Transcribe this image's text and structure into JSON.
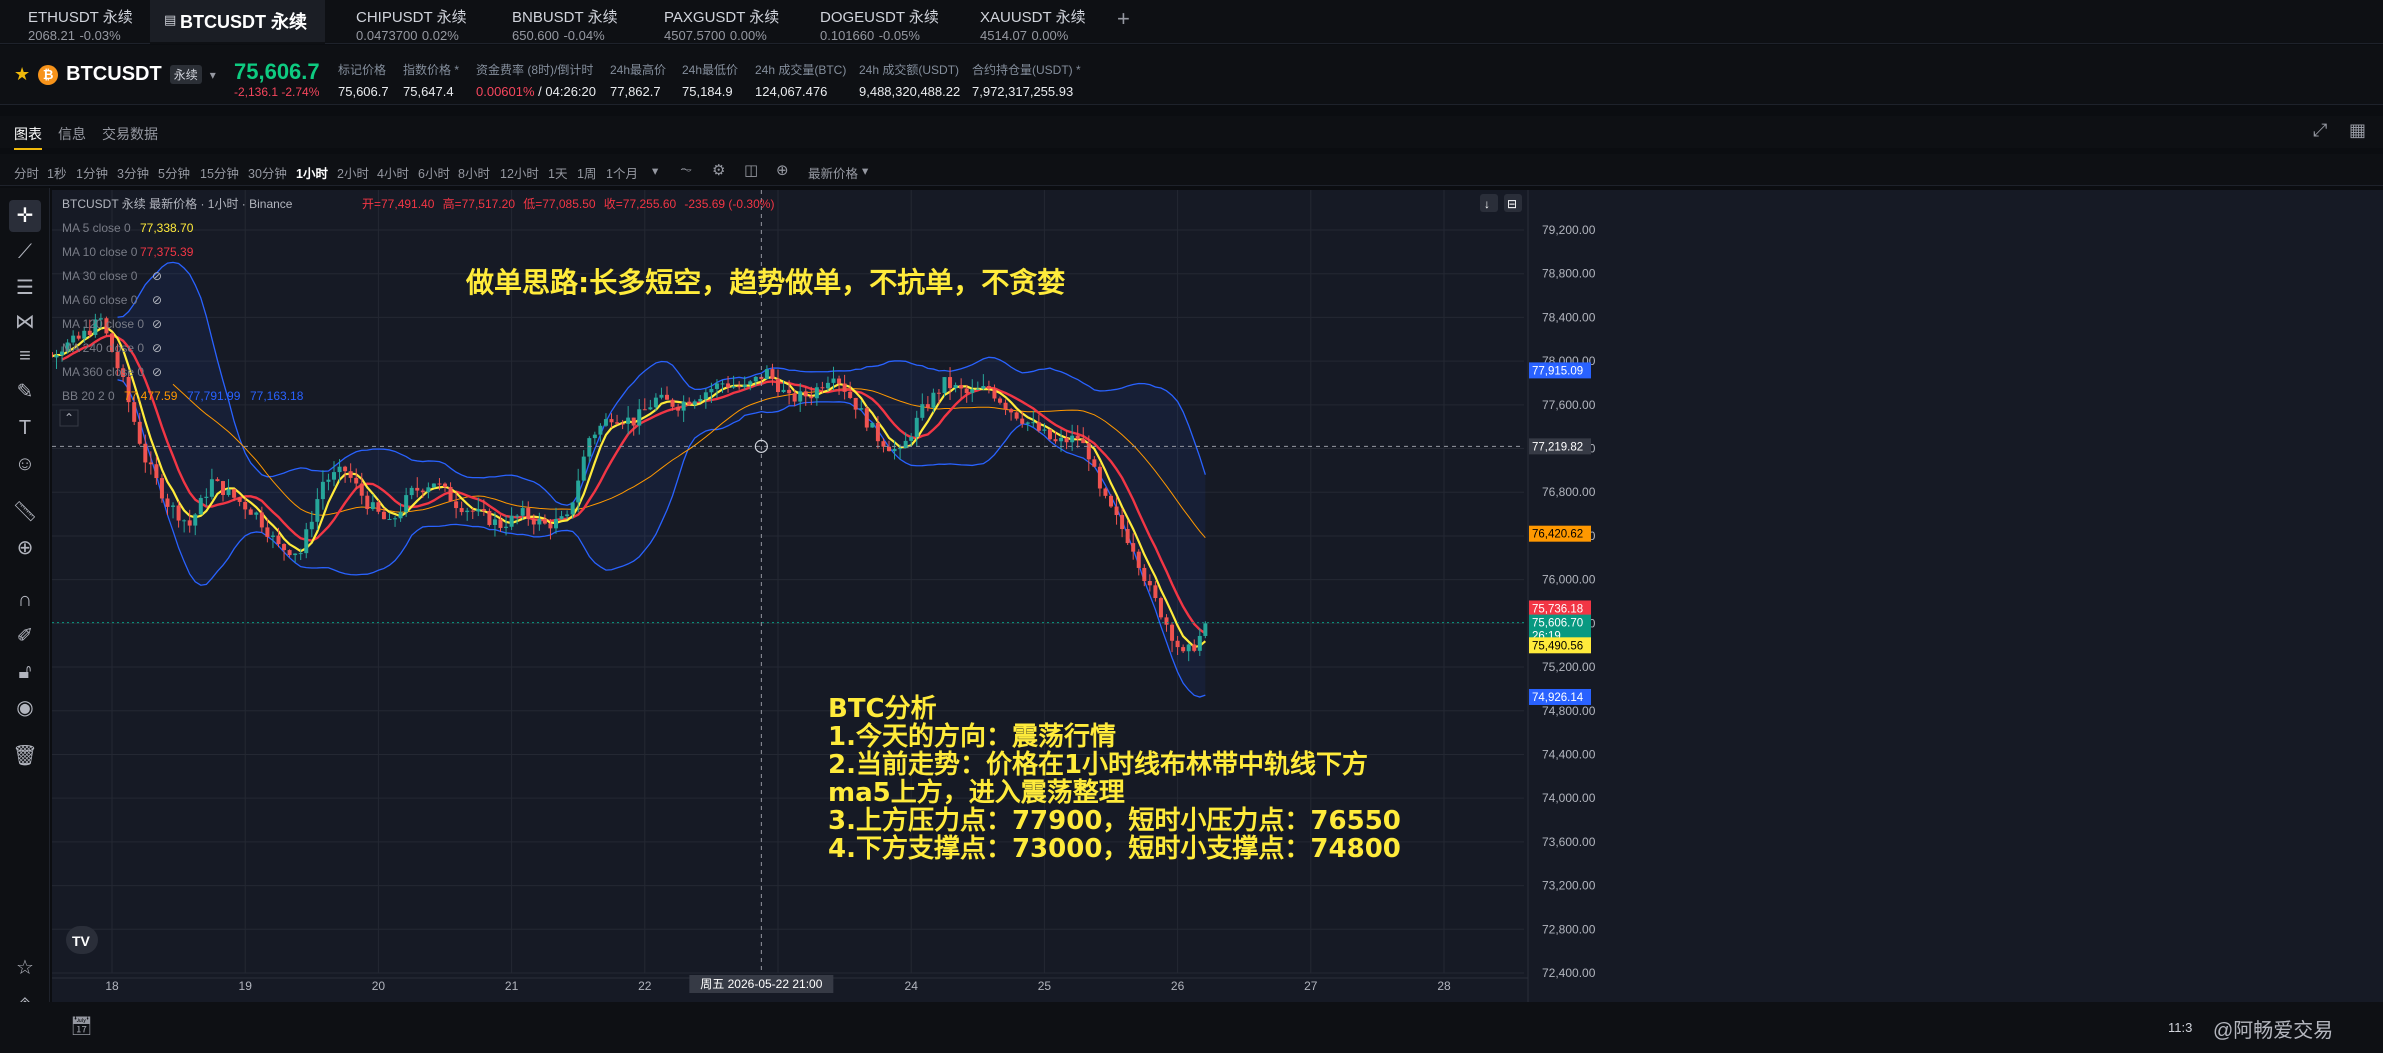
{
  "tabs": [
    {
      "name": "ETHUSDT 永续",
      "price": "2068.21",
      "change": "-0.03%",
      "dir": "neg"
    },
    {
      "name": "BTCUSDT 永续",
      "price": "",
      "change": "",
      "dir": "",
      "active": true
    },
    {
      "name": "CHIPUSDT 永续",
      "price": "0.0473700",
      "change": "0.02%",
      "dir": "pos"
    },
    {
      "name": "BNBUSDT 永续",
      "price": "650.600",
      "change": "-0.04%",
      "dir": "neg"
    },
    {
      "name": "PAXGUSDT 永续",
      "price": "4507.5700",
      "change": "0.00%",
      "dir": "pos"
    },
    {
      "name": "DOGEUSDT 永续",
      "price": "0.101660",
      "change": "-0.05%",
      "dir": "neg"
    },
    {
      "name": "XAUUSDT 永续",
      "price": "4514.07",
      "change": "0.00%",
      "dir": "pos"
    }
  ],
  "add_tab": "+",
  "header": {
    "symbol": "BTCUSDT",
    "badge": "永续",
    "last_price": "75,606.7",
    "change": "-2,136.1 -2.74%",
    "stats": [
      {
        "label": "标记价格",
        "value": "75,606.7",
        "cls": ""
      },
      {
        "label": "指数价格 *",
        "value": "75,647.4",
        "cls": ""
      },
      {
        "label": "资金费率 (8时)/倒计时",
        "value": "0.00601%",
        "value2": " / 04:26:20",
        "cls": "neg"
      },
      {
        "label": "24h最高价",
        "value": "77,862.7",
        "cls": ""
      },
      {
        "label": "24h最低价",
        "value": "75,184.9",
        "cls": ""
      },
      {
        "label": "24h 成交量(BTC)",
        "value": "124,067.476",
        "cls": ""
      },
      {
        "label": "24h 成交额(USDT)",
        "value": "9,488,320,488.22",
        "cls": ""
      },
      {
        "label": "合约持仓量(USDT) *",
        "value": "7,972,317,255.93",
        "cls": ""
      }
    ]
  },
  "subtabs": [
    "图表",
    "信息",
    "交易数据"
  ],
  "timeframes": [
    "分时",
    "1秒",
    "1分钟",
    "3分钟",
    "5分钟",
    "15分钟",
    "30分钟",
    "1小时",
    "2小时",
    "4小时",
    "6小时",
    "8小时",
    "12小时",
    "1天",
    "1周",
    "1个月"
  ],
  "active_timeframe": "1小时",
  "price_type": "最新价格",
  "chart_data": {
    "type": "candlestick",
    "title": "BTCUSDT 永续 最新价格 · 1小时 · Binance",
    "ohlc": {
      "open": "开=77,491.40",
      "high": "高=77,517.20",
      "low": "低=77,085.50",
      "close": "收=77,255.60",
      "change": "-235.69 (-0.30%)"
    },
    "indicators": [
      {
        "label": "MA 5 close 0",
        "value": "77,338.70",
        "color": "#ffeb3b"
      },
      {
        "label": "MA 10 close 0",
        "value": "77,375.39",
        "color": "#f23645"
      },
      {
        "label": "MA 30 close 0",
        "value": "",
        "color": "#787b86"
      },
      {
        "label": "MA 60 close 0",
        "value": "",
        "color": "#787b86"
      },
      {
        "label": "MA 120 close 0",
        "value": "",
        "color": "#787b86"
      },
      {
        "label": "MA 240 close 0",
        "value": "",
        "color": "#787b86"
      },
      {
        "label": "MA 360 close 0",
        "value": "",
        "color": "#787b86"
      }
    ],
    "bb": {
      "label": "BB 20 2 0",
      "mid": "77,477.59",
      "upper": "77,791.99",
      "lower": "77,163.18"
    },
    "x_labels": [
      "18",
      "19",
      "20",
      "21",
      "22",
      "23",
      "24",
      "25",
      "26",
      "27",
      "28"
    ],
    "crosshair_time": "周五 2026-05-22  21:00",
    "y_range": [
      72400,
      79200
    ],
    "y_ticks": [
      "79,200.00",
      "78,800.00",
      "78,400.00",
      "78,000.00",
      "77,600.00",
      "77,200.00",
      "76,800.00",
      "76,400.00",
      "76,000.00",
      "75,600.00",
      "75,200.00",
      "74,800.00",
      "74,400.00",
      "74,000.00",
      "73,600.00",
      "73,200.00",
      "72,800.00",
      "72,400.00"
    ],
    "price_labels": [
      {
        "value": 77915.09,
        "text": "77,915.09",
        "color": "#2962ff"
      },
      {
        "value": 77219.82,
        "text": "77,219.82",
        "color": "#363a45"
      },
      {
        "value": 76420.62,
        "text": "76,420.62",
        "color": "#ff9800"
      },
      {
        "value": 75736.18,
        "text": "75,736.18",
        "color": "#f23645"
      },
      {
        "value": 75606.7,
        "text": "75,606.70",
        "sub": "26:19",
        "color": "#089981"
      },
      {
        "value": 75490.56,
        "text": "75,490.56",
        "color": "#ffeb3b"
      },
      {
        "value": 74926.14,
        "text": "74,926.14",
        "color": "#2962ff"
      }
    ],
    "colors": {
      "up": "#26a69a",
      "down": "#ef5350",
      "ma5": "#ffeb3b",
      "ma10": "#f23645",
      "ma30": "#ff9800",
      "bb": "#2962ff",
      "text_anno": "#ffeb3b"
    }
  },
  "annotations": {
    "headline": "做单思路:长多短空，趋势做单，不抗单，不贪婪",
    "analysis": [
      "BTC分析",
      "1.今天的方向：震荡行情",
      "2.当前走势：价格在1小时线布林带中轨线下方",
      "ma5上方，进入震荡整理",
      "3.上方压力点：77900，短时小压力点：76550",
      "4.下方支撑点：73000，短时小支撑点：74800"
    ]
  },
  "bottom": {
    "clock": "11:3",
    "watermark": "@阿畅爱交易"
  }
}
